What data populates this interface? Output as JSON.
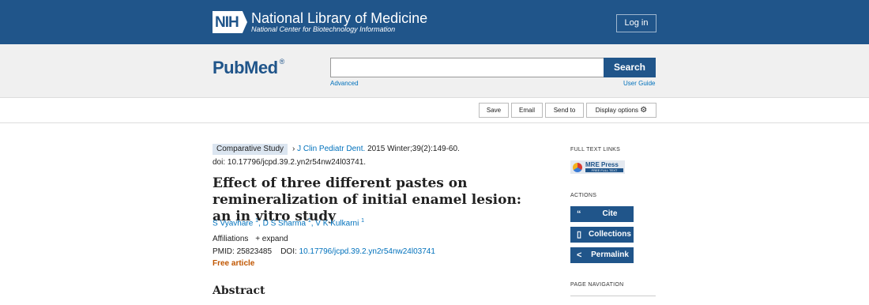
{
  "nih": {
    "logo_text": "NIH",
    "title": "National Library of Medicine",
    "subtitle": "National Center for Biotechnology Information",
    "login_label": "Log in"
  },
  "search": {
    "logo": "PubMed",
    "logo_mark": "®",
    "query": "",
    "button_label": "Search",
    "advanced_label": "Advanced",
    "guide_label": "User Guide"
  },
  "actions": {
    "save": "Save",
    "email": "Email",
    "send_to": "Send to",
    "display_options": "Display options"
  },
  "article": {
    "type_tag": "Comparative Study",
    "journal": "J Clin Pediatr Dent.",
    "citation": "2015 Winter;39(2):149-60.",
    "doi_line": "doi: 10.17796/jcpd.39.2.yn2r54nw24l03741.",
    "title": "Effect of three different pastes on remineralization of initial enamel lesion: an in vitro study",
    "authors": [
      {
        "name": "S Vyavhare",
        "aff": "1"
      },
      {
        "name": "D S Sharma",
        "aff": "1"
      },
      {
        "name": "V K Kulkarni",
        "aff": "1"
      }
    ],
    "affiliations_label": "Affiliations",
    "expand_label": "+ expand",
    "pmid_label": "PMID:",
    "pmid": "25823485",
    "doi_label": "DOI:",
    "doi": "10.17796/jcpd.39.2.yn2r54nw24l03741",
    "free_label": "Free article",
    "abstract_heading": "Abstract"
  },
  "sidebar": {
    "full_text_heading": "FULL TEXT LINKS",
    "provider_name": "MRE Press",
    "provider_tagline": "FREE FULL TEXT",
    "actions_heading": "ACTIONS",
    "cite_label": "Cite",
    "collections_label": "Collections",
    "permalink_label": "Permalink",
    "page_nav_heading": "PAGE NAVIGATION"
  }
}
